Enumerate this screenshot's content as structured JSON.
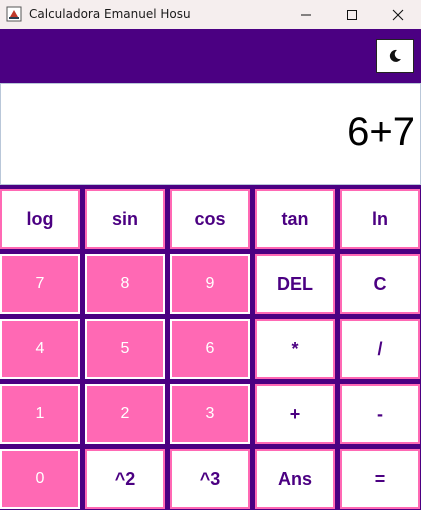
{
  "window": {
    "title": "Calculadora Emanuel Hosu",
    "minimize_symbol": "—",
    "maximize_symbol": "☐",
    "close_symbol": "✕"
  },
  "topbar": {
    "theme_icon": "moon-icon"
  },
  "display": {
    "expression": "6+7"
  },
  "colors": {
    "primary": "#4b0082",
    "pink": "#ff69b4",
    "white": "#ffffff"
  },
  "keys": {
    "r0": [
      "log",
      "sin",
      "cos",
      "tan",
      "ln"
    ],
    "r1": [
      "7",
      "8",
      "9",
      "DEL",
      "C"
    ],
    "r2": [
      "4",
      "5",
      "6",
      "*",
      "/"
    ],
    "r3": [
      "1",
      "2",
      "3",
      "+",
      "-"
    ],
    "r4": [
      "0",
      "^2",
      "^3",
      "Ans",
      "="
    ]
  }
}
